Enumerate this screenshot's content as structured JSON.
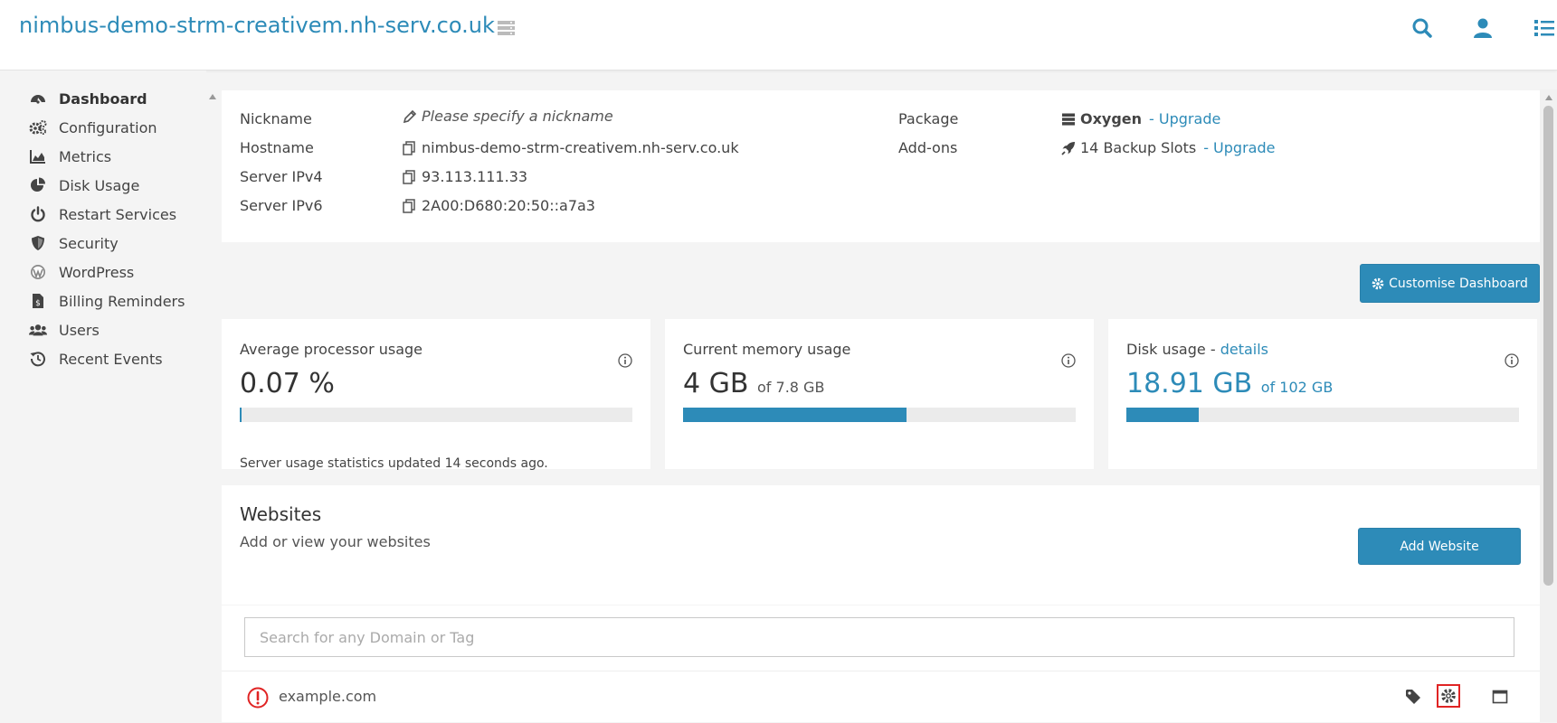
{
  "header": {
    "title": "nimbus-demo-strm-creativem.nh-serv.co.uk",
    "icons": [
      "server-list-icon",
      "search-icon",
      "user-icon",
      "menu-list-icon"
    ]
  },
  "colors": {
    "accent": "#2d8bb8",
    "error": "#e02424"
  },
  "sidebar": {
    "items": [
      {
        "label": "Dashboard",
        "icon": "dashboard-icon"
      },
      {
        "label": "Configuration",
        "icon": "gears-icon"
      },
      {
        "label": "Metrics",
        "icon": "area-chart-icon"
      },
      {
        "label": "Disk Usage",
        "icon": "pie-chart-icon"
      },
      {
        "label": "Restart Services",
        "icon": "power-icon"
      },
      {
        "label": "Security",
        "icon": "shield-icon"
      },
      {
        "label": "WordPress",
        "icon": "wordpress-icon"
      },
      {
        "label": "Billing Reminders",
        "icon": "invoice-icon"
      },
      {
        "label": "Users",
        "icon": "users-icon"
      },
      {
        "label": "Recent Events",
        "icon": "history-icon"
      }
    ]
  },
  "server_info": {
    "nickname_label": "Nickname",
    "nickname_placeholder": "Please specify a nickname",
    "hostname_label": "Hostname",
    "hostname": "nimbus-demo-strm-creativem.nh-serv.co.uk",
    "ipv4_label": "Server IPv4",
    "ipv4": "93.113.111.33",
    "ipv6_label": "Server IPv6",
    "ipv6": "2A00:D680:20:50::a7a3",
    "package_label": "Package",
    "package": "Oxygen",
    "package_upgrade": "- Upgrade",
    "addons_label": "Add-ons",
    "addons": "14 Backup Slots",
    "addons_upgrade": "- Upgrade"
  },
  "customise_button": "Customise Dashboard",
  "stats": {
    "cpu": {
      "title": "Average processor usage",
      "value": "0.07 %",
      "fraction": 0.0007
    },
    "memory": {
      "title": "Current memory usage",
      "value": "4 GB",
      "of": "of 7.8 GB",
      "fraction": 0.57
    },
    "disk": {
      "title": "Disk usage - ",
      "details_link": "details",
      "value": "18.91 GB",
      "of": "of 102 GB",
      "fraction": 0.185
    }
  },
  "updated_text": "Server usage statistics updated 14 seconds ago.",
  "websites": {
    "title": "Websites",
    "subtitle": "Add or view your websites",
    "add_button": "Add Website",
    "search_placeholder": "Search for any Domain or Tag",
    "rows": [
      {
        "domain": "example.com",
        "status_icon": "error-icon",
        "actions": [
          "tag-icon",
          "settings-gear-icon",
          "window-icon"
        ]
      }
    ]
  }
}
